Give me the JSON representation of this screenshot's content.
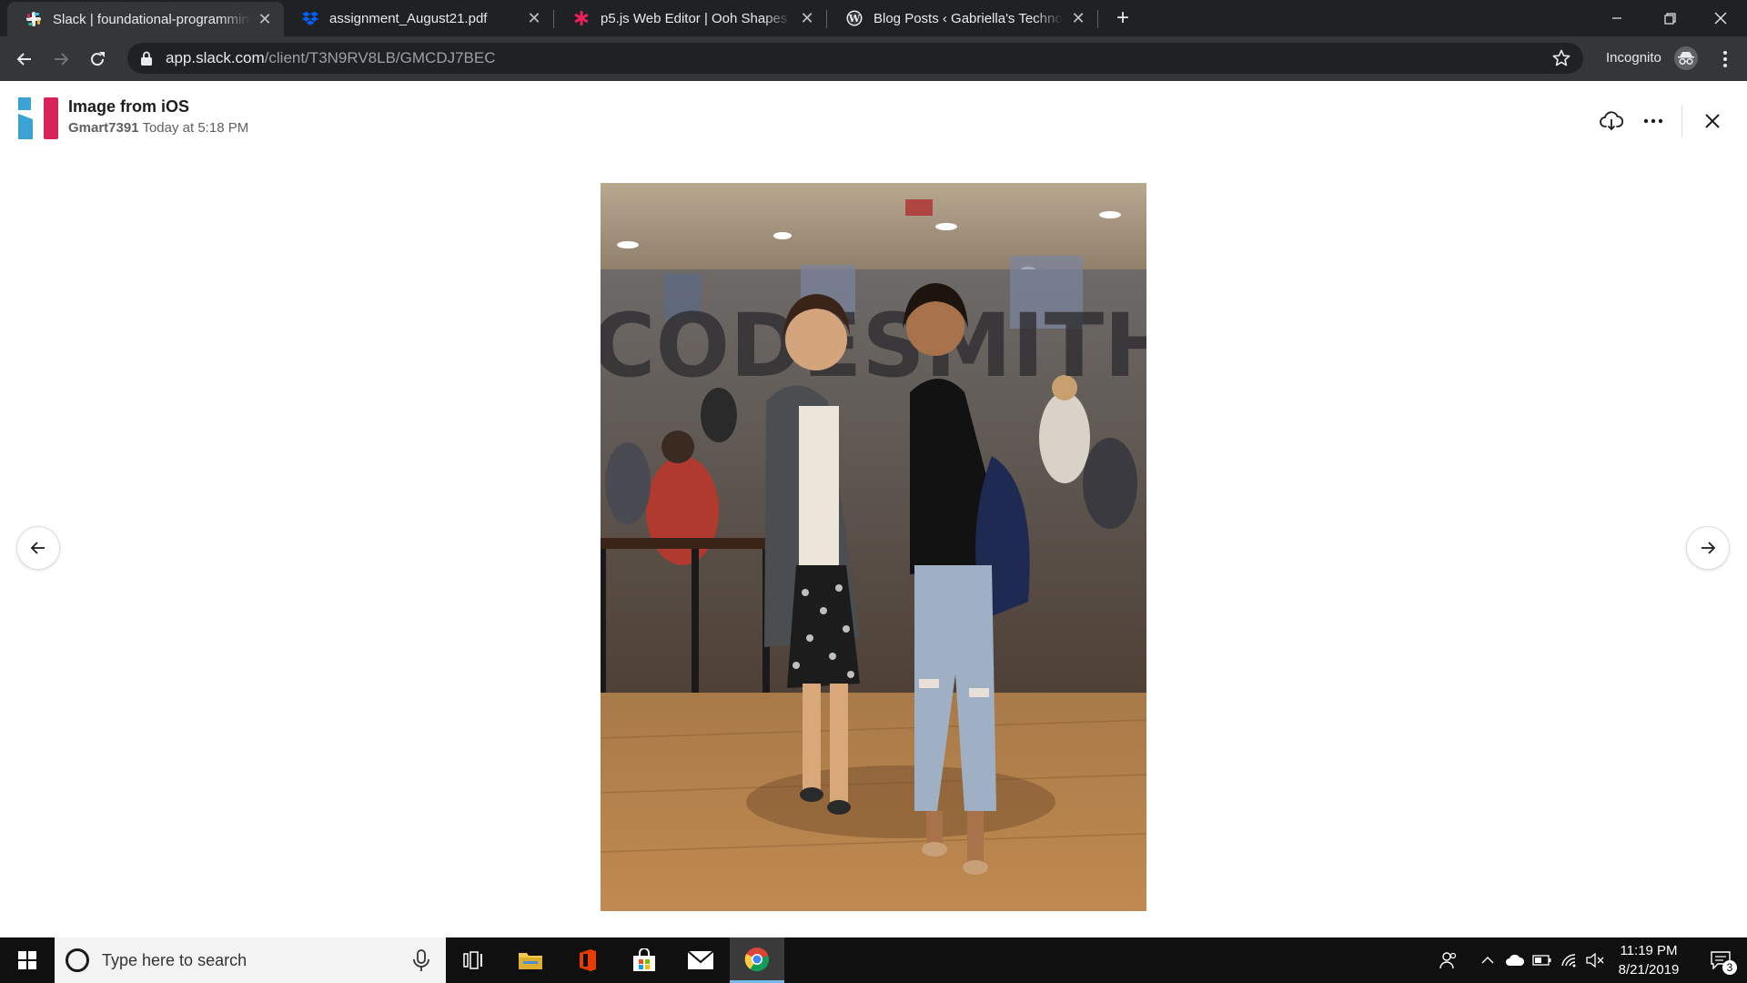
{
  "browser": {
    "tabs": [
      {
        "title": "Slack | foundational-programming",
        "favicon": "slack-icon",
        "active": true
      },
      {
        "title": "assignment_August21.pdf",
        "favicon": "dropbox-icon",
        "active": false
      },
      {
        "title": "p5.js Web Editor | Ooh Shapes",
        "favicon": "p5js-icon",
        "active": false
      },
      {
        "title": "Blog Posts ‹ Gabriella's Technology",
        "favicon": "wordpress-icon",
        "active": false
      }
    ],
    "address": {
      "host": "app.slack.com",
      "path": "/client/T3N9RV8LB/GMCDJ7BEC"
    },
    "profile_label": "Incognito",
    "colors": {
      "frame": "#202124",
      "toolbar": "#35363a",
      "text": "#e8eaed"
    }
  },
  "viewer": {
    "title": "Image from iOS",
    "author": "Gmart7391",
    "timestamp": "Today at 5:18 PM",
    "image_alt": "Photo of two people standing together in a room with a glass wall lettered CODESMITH",
    "photo_text": "CODESMITH"
  },
  "taskbar": {
    "search_placeholder": "Type here to search",
    "time": "11:19 PM",
    "date": "8/21/2019",
    "notification_count": "3",
    "pinned": [
      "task-view-icon",
      "file-explorer-icon",
      "office-icon",
      "store-icon",
      "mail-icon",
      "chrome-icon"
    ]
  }
}
